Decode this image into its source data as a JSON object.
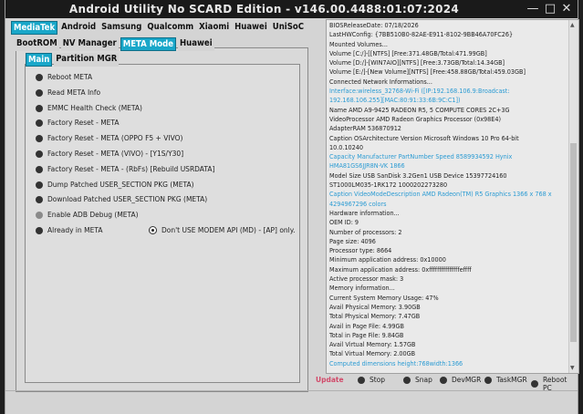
{
  "window": {
    "title": "Android Utility No SCARD Edition - v146.00.4488:01:07:2024"
  },
  "main_tabs": [
    {
      "label": "MediaTek",
      "active": true
    },
    {
      "label": "Android",
      "active": false
    },
    {
      "label": "Samsung",
      "active": false
    },
    {
      "label": "Qualcomm",
      "active": false
    },
    {
      "label": "Xiaomi",
      "active": false
    },
    {
      "label": "Huawei",
      "active": false
    },
    {
      "label": "UniSoC",
      "active": false
    }
  ],
  "sub_tabs": [
    {
      "label": "BootROM",
      "active": false
    },
    {
      "label": "NV Manager",
      "active": false
    },
    {
      "label": "META Mode",
      "active": true
    },
    {
      "label": "Huawei",
      "active": false
    }
  ],
  "inner_tabs": [
    {
      "label": "Main",
      "active": true
    },
    {
      "label": "Partition MGR",
      "active": false
    }
  ],
  "options": [
    {
      "label": "Reboot META",
      "light": false
    },
    {
      "label": "Read META Info",
      "light": false
    },
    {
      "label": "EMMC Health Check (META)",
      "light": false
    },
    {
      "label": "Factory Reset - META",
      "light": false
    },
    {
      "label": "Factory Reset - META (OPPO F5 + VIVO)",
      "light": false
    },
    {
      "label": "Factory Reset - META (VIVO) - [Y1S/Y30]",
      "light": false
    },
    {
      "label": "Factory Reset - META - (RbFs) [Rebuild USRDATA]",
      "light": false
    },
    {
      "label": "Dump Patched USER_SECTION PKG (META)",
      "light": false
    },
    {
      "label": "Download Patched USER_SECTION PKG (META)",
      "light": false
    },
    {
      "label": "Enable ADB Debug (META)",
      "light": true
    },
    {
      "label": "Already in META",
      "light": false
    }
  ],
  "modem_option": "Don't USE MODEM API (MD) - [AP] only.",
  "log_lines": [
    {
      "text": "BIOSReleaseDate: 07/18/2026",
      "blue": false
    },
    {
      "text": "LastHWConfig: {7BB510B0-82AE-E911-8102-9BB46A70FC26}",
      "blue": false
    },
    {
      "text": "Mounted Volumes...",
      "blue": false
    },
    {
      "text": "Volume [C:/]-[[NTFS] [Free:371.48GB/Total:471.99GB]",
      "blue": false
    },
    {
      "text": "Volume [D:/]-[WIN7AIO][NTFS] [Free:3.73GB/Total:14.34GB]",
      "blue": false
    },
    {
      "text": "Volume [E:/]-[New Volume][NTFS] [Free:458.88GB/Total:459.03GB]",
      "blue": false
    },
    {
      "text": "Connected Network Informations...",
      "blue": false
    },
    {
      "text": "Interface:wireless_32768-Wi-Fi ([IP:192.168.106.9:Broadcast:",
      "blue": true
    },
    {
      "text": "192.168.106.255][MAC:80:91:33:6B:9C:C1])",
      "blue": true
    },
    {
      "text": "Name AMD A9-9425 RADEON R5, 5 COMPUTE CORES 2C+3G",
      "blue": false
    },
    {
      "text": "VideoProcessor AMD Radeon Graphics Processor (0x98E4)",
      "blue": false
    },
    {
      "text": "AdapterRAM 536870912",
      "blue": false
    },
    {
      "text": "Caption OSArchitecture Version Microsoft Windows 10 Pro 64-bit",
      "blue": false
    },
    {
      "text": "10.0.10240",
      "blue": false
    },
    {
      "text": "Capacity Manufacturer PartNumber Speed 8589934592 Hynix",
      "blue": true
    },
    {
      "text": "HMA81GS6JJR8N-VK 1866",
      "blue": true
    },
    {
      "text": "Model Size USB SanDisk 3.2Gen1 USB Device 15397724160",
      "blue": false
    },
    {
      "text": "ST1000LM035-1RK172 1000202273280",
      "blue": false
    },
    {
      "text": "Caption VideoModeDescription AMD Radeon(TM) R5 Graphics 1366 x 768 x",
      "blue": true
    },
    {
      "text": "4294967296 colors",
      "blue": true
    },
    {
      "text": "Hardware information...",
      "blue": false
    },
    {
      "text": "OEM ID: 9",
      "blue": false
    },
    {
      "text": "Number of processors: 2",
      "blue": false
    },
    {
      "text": "Page size: 4096",
      "blue": false
    },
    {
      "text": "Processor type: 8664",
      "blue": false
    },
    {
      "text": "Minimum application address: 0x10000",
      "blue": false
    },
    {
      "text": "Maximum application address: 0xfffffffffffffffeffff",
      "blue": false
    },
    {
      "text": "Active processor mask: 3",
      "blue": false
    },
    {
      "text": "Memory information...",
      "blue": false
    },
    {
      "text": "Current System Memory Usage: 47%",
      "blue": false
    },
    {
      "text": "Avail Physical Memory: 3.90GB",
      "blue": false
    },
    {
      "text": "Total Physical Memory: 7.47GB",
      "blue": false
    },
    {
      "text": "Avail in Page File: 4.99GB",
      "blue": false
    },
    {
      "text": "Total in Page File: 9.84GB",
      "blue": false
    },
    {
      "text": "Avail Virtual Memory: 1.57GB",
      "blue": false
    },
    {
      "text": "Total Virtual Memory: 2.00GB",
      "blue": false
    },
    {
      "text": "Computed dimensions height:768width:1366",
      "blue": true
    }
  ],
  "bottom_bar": {
    "update_label": "Update",
    "buttons": [
      "Stop",
      "Snap",
      "DevMGR",
      "TaskMGR",
      "Reboot PC"
    ]
  },
  "colors": {
    "accent": "#19a7c9",
    "update": "#d24a6a",
    "log_blue": "#2b9bd3"
  }
}
